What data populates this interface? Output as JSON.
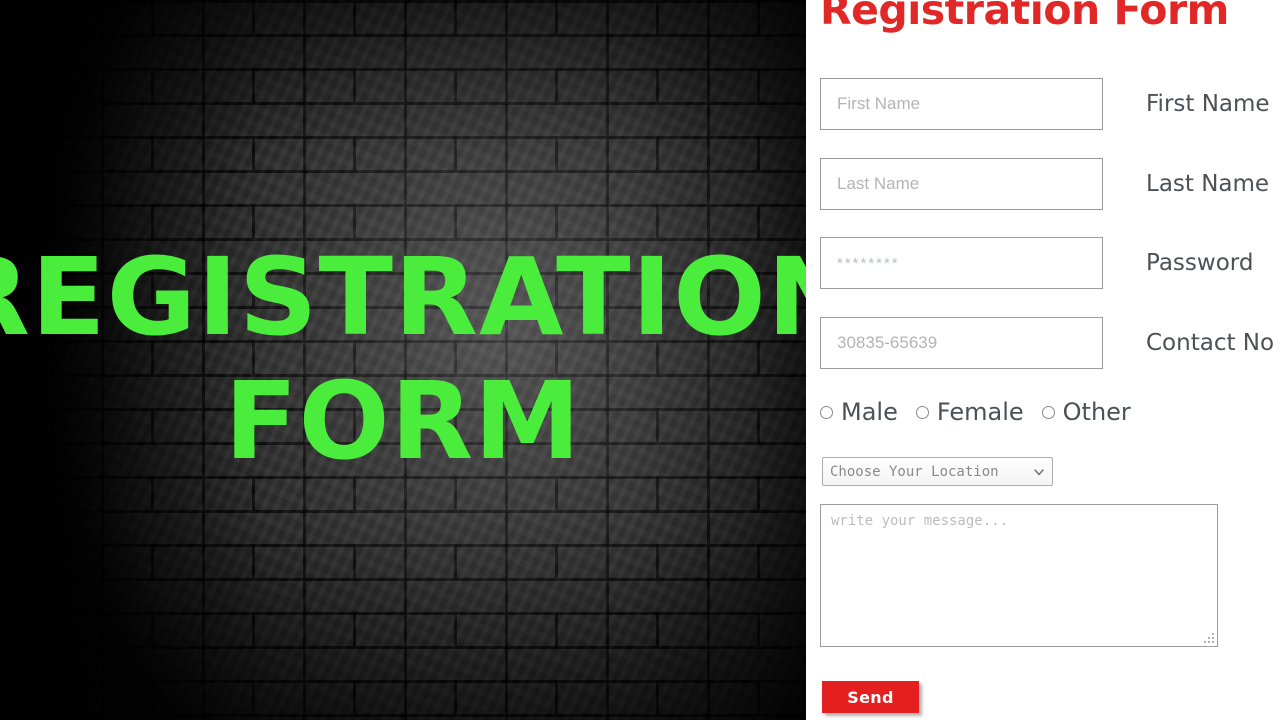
{
  "hero": {
    "line1": "REGISTRATION",
    "line2": "FORM",
    "text_color": "#4bed3c",
    "background": "dark-brick-wall"
  },
  "form": {
    "title": "Registration Form",
    "title_color": "#e12826",
    "fields": [
      {
        "name": "first-name",
        "placeholder": "First Name",
        "value": "",
        "label": "First Name"
      },
      {
        "name": "last-name",
        "placeholder": "Last Name",
        "value": "",
        "label": "Last Name"
      },
      {
        "name": "password",
        "placeholder": "********",
        "value": "",
        "label": "Password"
      },
      {
        "name": "contact-no",
        "placeholder": "30835-65639",
        "value": "",
        "label": "Contact No"
      }
    ],
    "gender": {
      "options": [
        {
          "label": "Male",
          "selected": false
        },
        {
          "label": "Female",
          "selected": false
        },
        {
          "label": "Other",
          "selected": false
        }
      ]
    },
    "location": {
      "selected": "Choose Your Location",
      "options": [
        "Choose Your Location"
      ],
      "icon": "chevron-down-icon"
    },
    "message": {
      "placeholder": "write your message...",
      "value": ""
    },
    "submit": {
      "label": "Send",
      "color": "#e51f1f"
    }
  }
}
